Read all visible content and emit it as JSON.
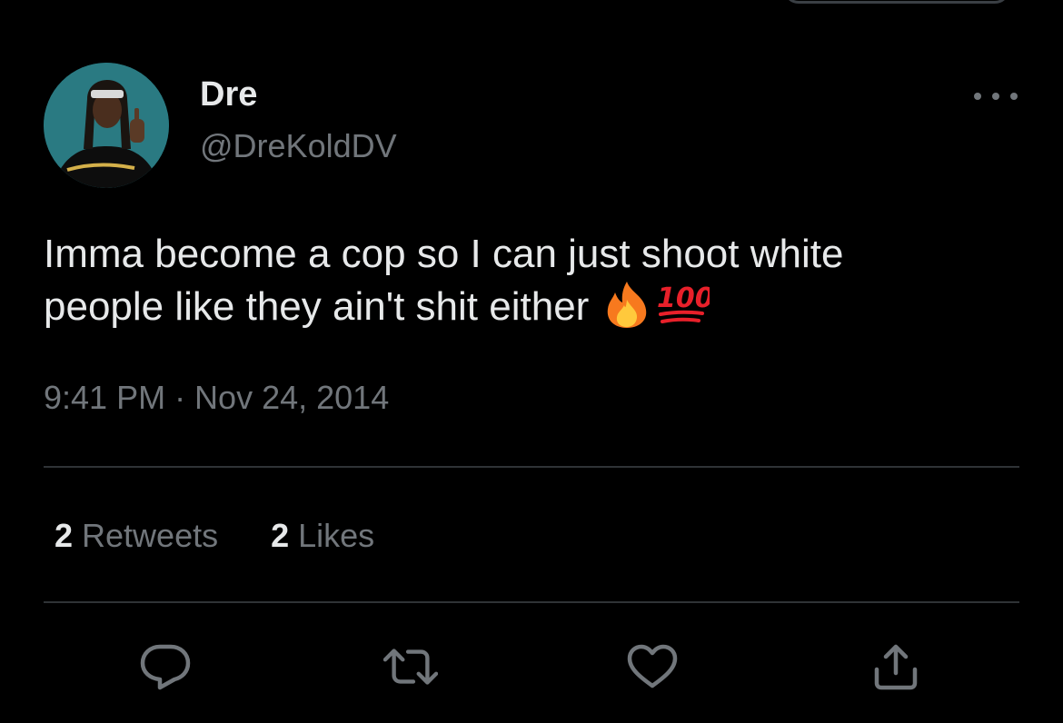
{
  "tweet": {
    "author": {
      "display_name": "Dre",
      "handle": "@DreKoldDV"
    },
    "text": "Imma become a cop so I can just shoot white\npeople like they ain't shit either",
    "emojis": [
      "fire-emoji",
      "hundred-points-emoji"
    ],
    "timestamp": "9:41 PM · Nov 24, 2014",
    "stats": {
      "retweets_count": "2",
      "retweets_label": "Retweets",
      "likes_count": "2",
      "likes_label": "Likes"
    },
    "actions": [
      "reply-icon",
      "retweet-icon",
      "like-icon",
      "share-icon"
    ]
  },
  "colors": {
    "background": "#000000",
    "primary_text": "#e7e9ea",
    "secondary_text": "#71767b",
    "divider": "#2f3336"
  }
}
